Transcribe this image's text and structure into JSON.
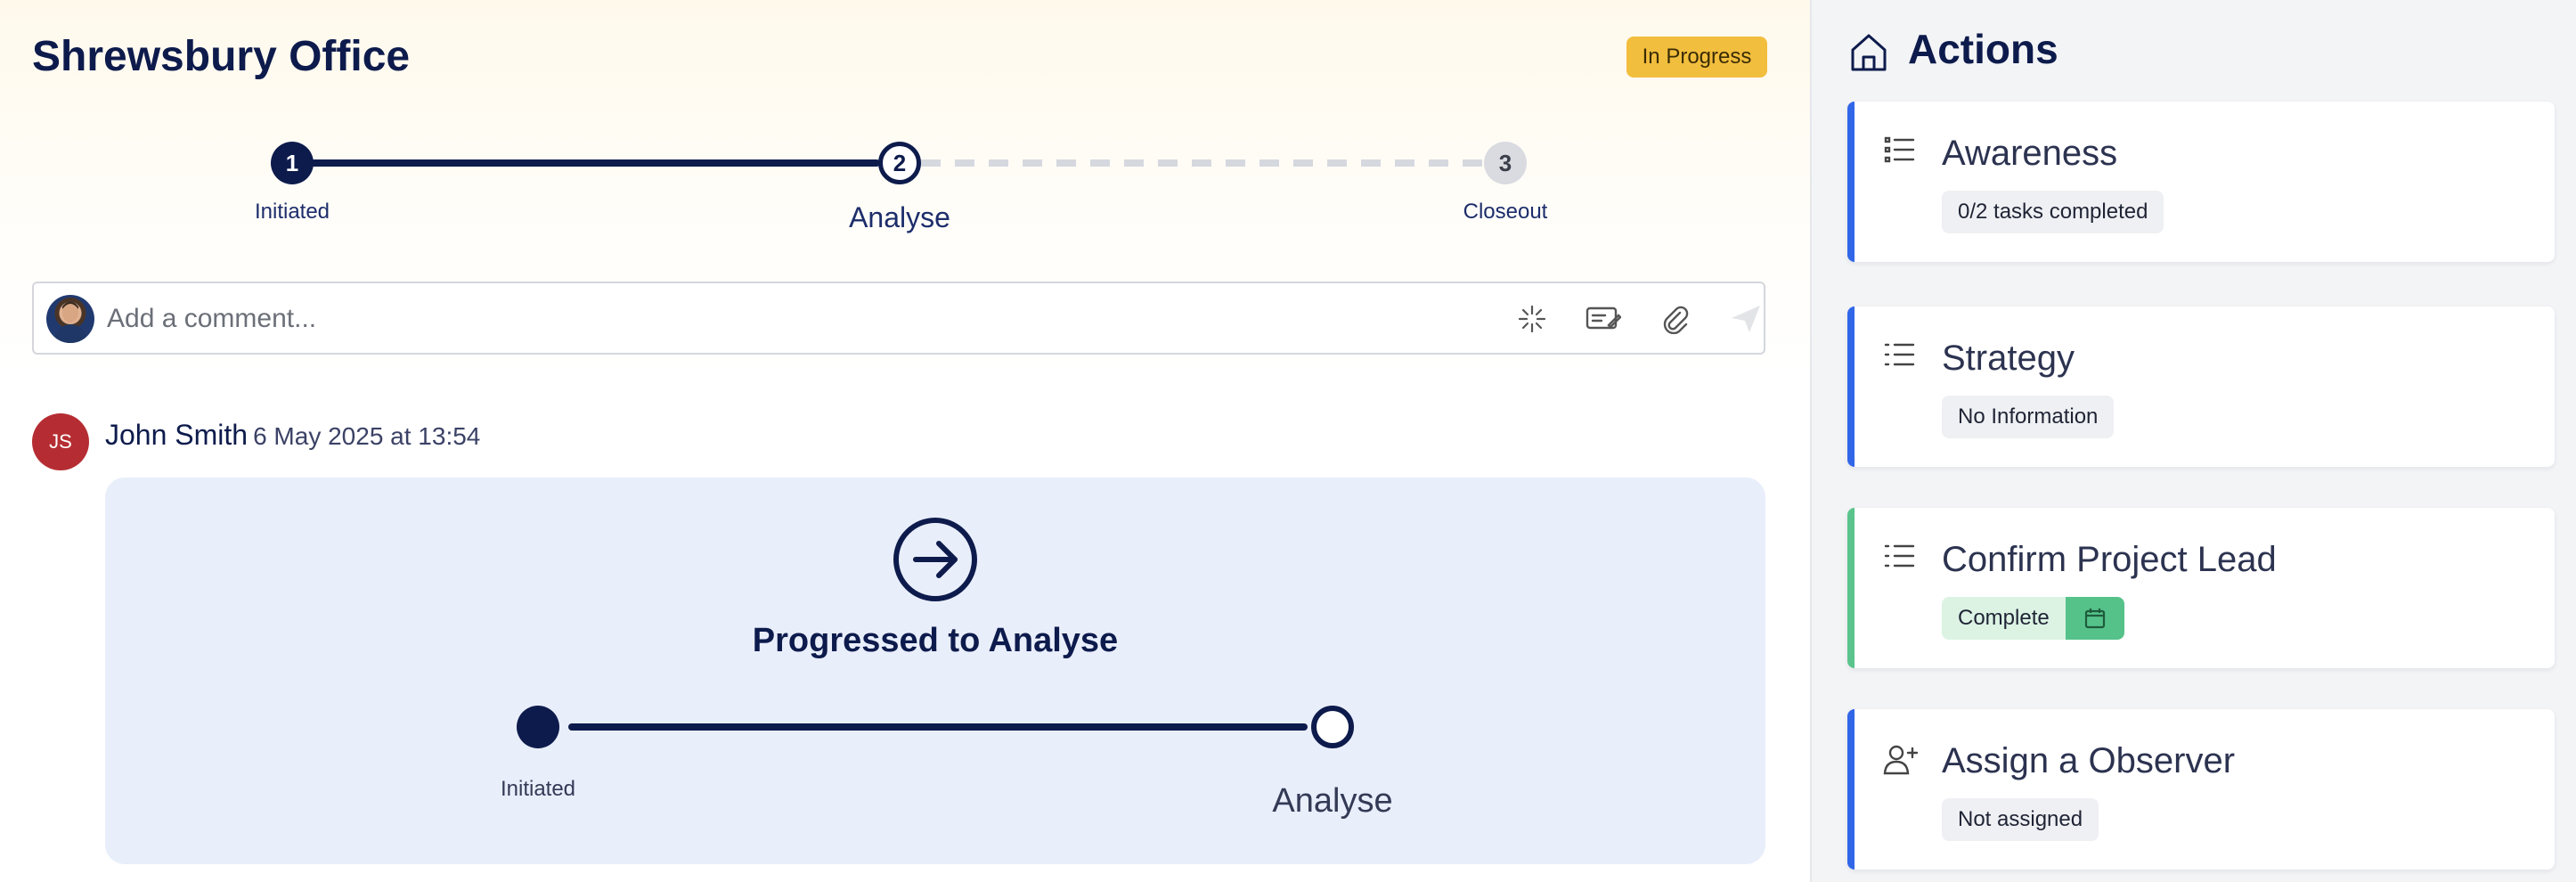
{
  "header": {
    "title": "Shrewsbury Office",
    "status": "In Progress"
  },
  "stepper": {
    "steps": [
      {
        "number": "1",
        "label": "Initiated",
        "state": "done"
      },
      {
        "number": "2",
        "label": "Analyse",
        "state": "current"
      },
      {
        "number": "3",
        "label": "Closeout",
        "state": "todo"
      }
    ]
  },
  "comment": {
    "placeholder": "Add a comment...",
    "tools": [
      "sparkle-icon",
      "signature-icon",
      "paperclip-icon",
      "send-icon"
    ]
  },
  "entry": {
    "initials": "JS",
    "author": "John Smith",
    "timestamp": "6 May 2025 at 13:54",
    "event_title": "Progressed to Analyse",
    "from_label": "Initiated",
    "to_label": "Analyse"
  },
  "sidebar": {
    "title": "Actions",
    "cards": [
      {
        "title": "Awareness",
        "badge": "0/2 tasks completed",
        "icon": "list-icon",
        "accent": "#3166e8"
      },
      {
        "title": "Strategy",
        "badge": "No Information",
        "icon": "list-icon",
        "accent": "#3166e8"
      },
      {
        "title": "Confirm Project Lead",
        "badge": "Complete",
        "icon": "list-icon",
        "accent": "#5bc48c"
      },
      {
        "title": "Assign a Observer",
        "badge": "Not assigned",
        "icon": "add-user-icon",
        "accent": "#3166e8"
      }
    ]
  },
  "colors": {
    "navy": "#0d1b4c",
    "status_badge": "#f2be3d",
    "avatar_red": "#b52d32",
    "event_card_bg": "#e9eefb",
    "complete_green": "#55c28a"
  }
}
